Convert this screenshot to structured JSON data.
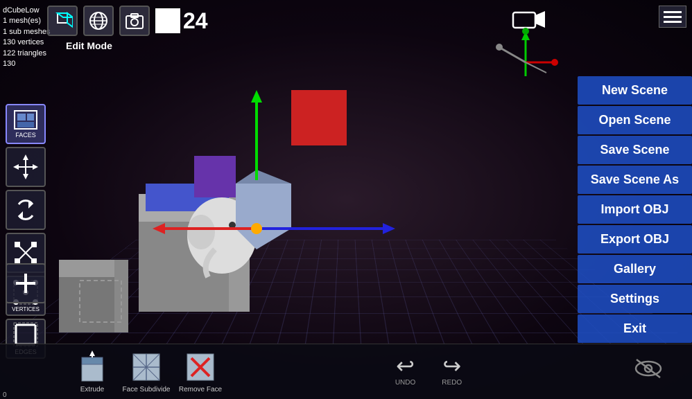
{
  "info": {
    "object_name": "dCubeLow",
    "meshes": "1 mesh(es)",
    "sub_meshes": "1 sub meshes",
    "vertices": "130 vertices",
    "triangles": "122 triangles",
    "extra": "130"
  },
  "toolbar": {
    "edit_mode_label": "Edit Mode",
    "frame_number": "24",
    "coord": "0"
  },
  "menu": {
    "new_scene": "New Scene",
    "open_scene": "Open Scene",
    "save_scene": "Save Scene",
    "save_scene_as": "Save Scene As",
    "import_obj": "Import OBJ",
    "export_obj": "Export OBJ",
    "gallery": "Gallery",
    "settings": "Settings",
    "exit": "Exit"
  },
  "left_tools": [
    {
      "id": "faces",
      "label": "FACES",
      "active": true
    },
    {
      "id": "move",
      "label": ""
    },
    {
      "id": "undo-rotate",
      "label": ""
    },
    {
      "id": "scale",
      "label": ""
    },
    {
      "id": "vertices",
      "label": "VERTICES"
    },
    {
      "id": "edges",
      "label": "EDGES"
    }
  ],
  "bottom_tools": [
    {
      "id": "extrude",
      "label": "Extrude"
    },
    {
      "id": "face-subdivide",
      "label": "Face Subdivide"
    },
    {
      "id": "remove-face",
      "label": "Remove Face"
    }
  ],
  "undo_redo": {
    "undo": "UNDO",
    "redo": "REDO"
  },
  "colors": {
    "menu_bg": "#1e50c8",
    "toolbar_bg": "#0a0a14"
  }
}
